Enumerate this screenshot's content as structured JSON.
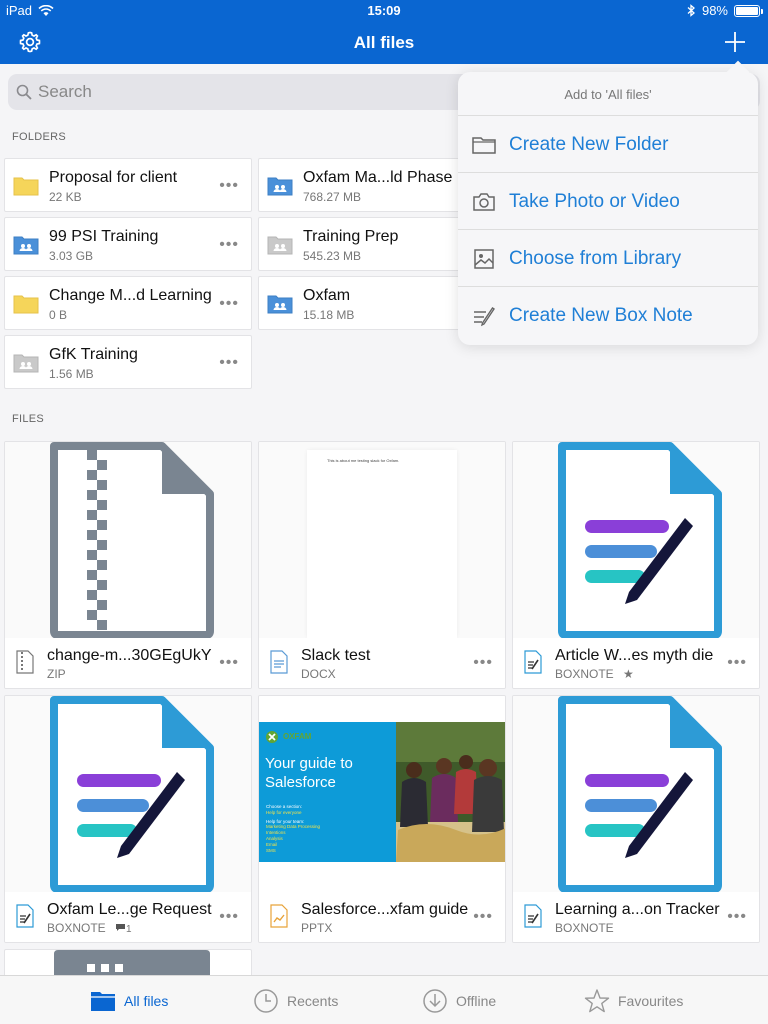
{
  "status": {
    "device": "iPad",
    "time": "15:09",
    "battery": "98%",
    "battery_level": 0.98
  },
  "nav": {
    "title": "All files"
  },
  "search": {
    "placeholder": "Search"
  },
  "sections": {
    "folders": "FOLDERS",
    "files": "FILES"
  },
  "folders": [
    {
      "name": "Proposal for client",
      "size": "22 KB",
      "kind": "yellow"
    },
    {
      "name": "Oxfam Ma...ld Phase 1",
      "size": "768.27 MB",
      "kind": "shared"
    },
    {
      "name": "99 PSI Training",
      "size": "3.03 GB",
      "kind": "shared"
    },
    {
      "name": "Training Prep",
      "size": "545.23 MB",
      "kind": "grey"
    },
    {
      "name": "Change M...d Learning",
      "size": "0 B",
      "kind": "yellow"
    },
    {
      "name": "Oxfam",
      "size": "15.18 MB",
      "kind": "shared"
    },
    {
      "name": "GfK Training",
      "size": "1.56 MB",
      "kind": "grey"
    }
  ],
  "more_glyph": "•••",
  "files": [
    {
      "name": "change-m...30GEgUkY",
      "type": "ZIP",
      "thumb": "zip"
    },
    {
      "name": "Slack test",
      "type": "DOCX",
      "thumb": "doc",
      "doc_text": "This is about me testing slack for Oxfam."
    },
    {
      "name": "Article W...es myth die",
      "type": "BOXNOTE",
      "thumb": "boxnote",
      "badge": "★"
    },
    {
      "name": "Oxfam Le...ge Request",
      "type": "BOXNOTE",
      "thumb": "boxnote",
      "comment_count": "1"
    },
    {
      "name": "Salesforce...xfam guide",
      "type": "PPTX",
      "thumb": "pptx"
    },
    {
      "name": "Learning a...on Tracker",
      "type": "BOXNOTE",
      "thumb": "boxnote"
    }
  ],
  "pptx": {
    "brand": "OXFAM",
    "heading_line1": "Your guide to",
    "heading_line2": "Salesforce",
    "lines": [
      "Choose a section:",
      "Help for everyone",
      "Help for your team:",
      "Marketing Data Processing",
      "Intentions",
      "Analysis",
      "Email",
      "SMS"
    ]
  },
  "menu": {
    "header": "Add to 'All files'",
    "items": [
      {
        "label": "Create New Folder",
        "icon": "folder-outline-icon"
      },
      {
        "label": "Take Photo or Video",
        "icon": "camera-icon"
      },
      {
        "label": "Choose from Library",
        "icon": "image-icon"
      },
      {
        "label": "Create New Box Note",
        "icon": "boxnote-pen-icon"
      }
    ]
  },
  "tabs": [
    {
      "label": "All files",
      "active": true
    },
    {
      "label": "Recents",
      "active": false
    },
    {
      "label": "Offline",
      "active": false
    },
    {
      "label": "Favourites",
      "active": false
    }
  ],
  "colors": {
    "brand_blue": "#0a66d1",
    "link_blue": "#1f7fd6",
    "folder_yellow": "#f5d55a",
    "folder_blue": "#4a90d9",
    "folder_grey": "#c9c9c9",
    "boxnote_blue": "#2d9bd6",
    "pptx_blue": "#0d9bd8"
  }
}
